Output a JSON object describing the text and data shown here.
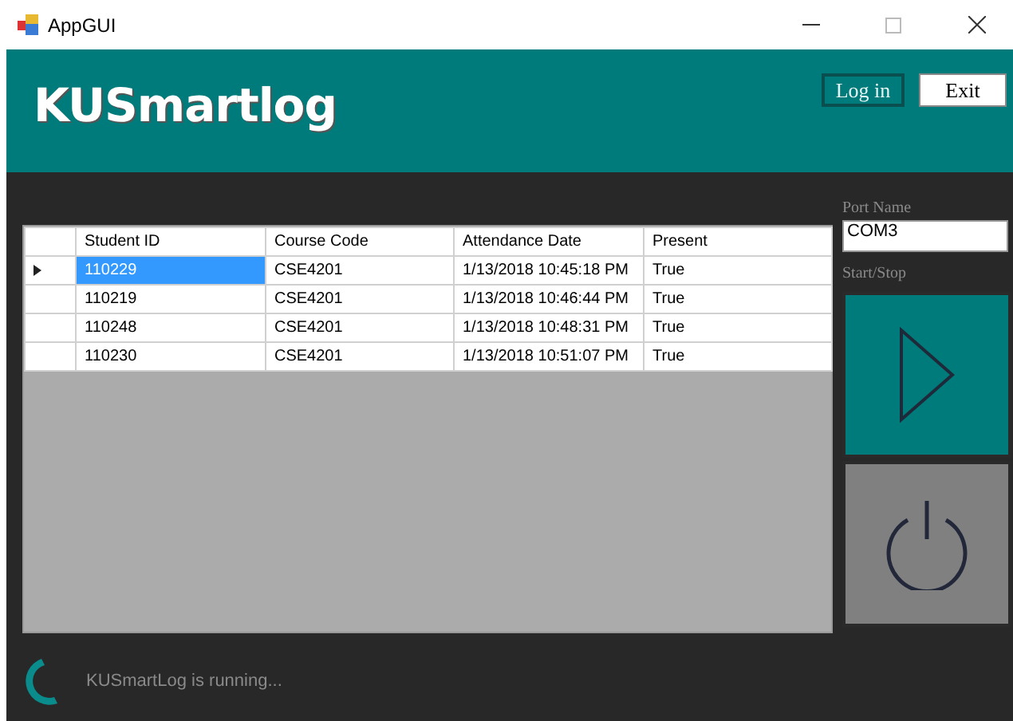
{
  "window": {
    "title": "AppGUI"
  },
  "header": {
    "logo": "KUSmartlog",
    "buttons": [
      {
        "label": "Log in",
        "kind": "outline"
      },
      {
        "label": "Exit",
        "kind": "solid"
      }
    ]
  },
  "table": {
    "columns": [
      "Student ID",
      "Course Code",
      "Attendance Date",
      "Present"
    ],
    "rows": [
      {
        "cells": [
          "110229",
          "CSE4201",
          "1/13/2018 10:45:18 PM",
          "True"
        ],
        "selected": true
      },
      {
        "cells": [
          "110219",
          "CSE4201",
          "1/13/2018 10:46:44 PM",
          "True"
        ],
        "selected": false
      },
      {
        "cells": [
          "110248",
          "CSE4201",
          "1/13/2018 10:48:31 PM",
          "True"
        ],
        "selected": false
      },
      {
        "cells": [
          "110230",
          "CSE4201",
          "1/13/2018 10:51:07 PM",
          "True"
        ],
        "selected": false
      }
    ]
  },
  "port": {
    "label": "Port Name",
    "value": "COM3"
  },
  "start_stop": {
    "label": "Start/Stop"
  },
  "status_bar": {
    "text": "KUSmartLog is running..."
  }
}
